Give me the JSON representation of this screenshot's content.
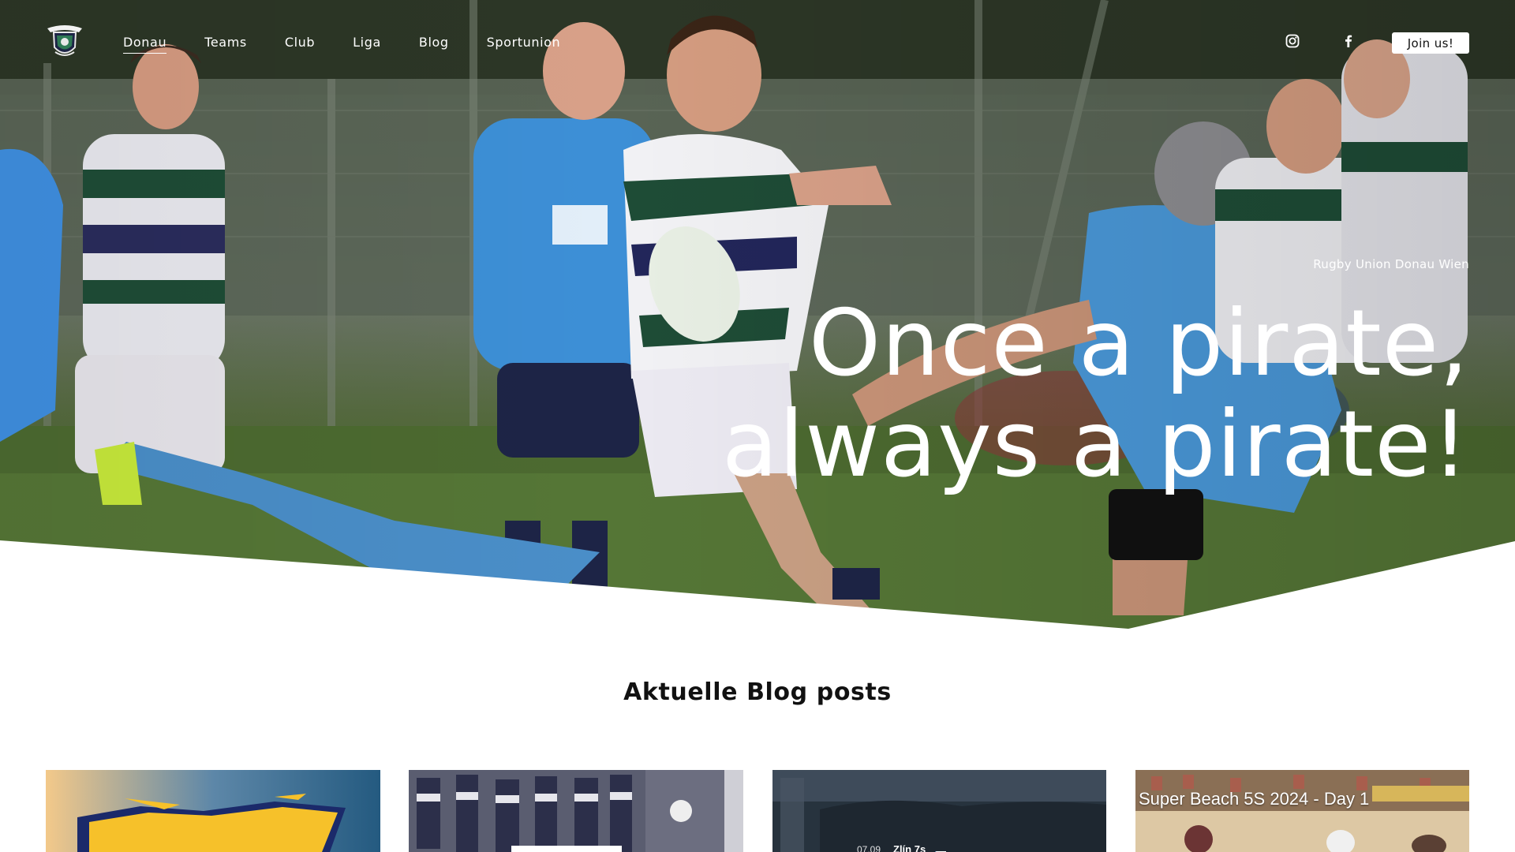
{
  "nav": {
    "logo_icon": "club-crest-icon",
    "links": [
      {
        "label": "Donau",
        "active": true
      },
      {
        "label": "Teams",
        "active": false
      },
      {
        "label": "Club",
        "active": false
      },
      {
        "label": "Liga",
        "active": false
      },
      {
        "label": "Blog",
        "active": false
      },
      {
        "label": "Sportunion",
        "active": false
      }
    ],
    "social_icons": [
      "instagram-icon",
      "facebook-icon"
    ],
    "join_label": "Join us!"
  },
  "hero": {
    "eyebrow": "Rugby Union Donau Wien",
    "title_line1": "Once a pirate,",
    "title_line2": "always a pirate!",
    "image": "rugby-match-photo"
  },
  "blog": {
    "section_title": "Aktuelle Blog posts",
    "cards": [
      {
        "image": "rugby-logo-artwork",
        "overlay": ""
      },
      {
        "image": "magazine-spread-photo",
        "overlay": ""
      },
      {
        "image": "dark-field-photo",
        "overlay_date": "07.09",
        "overlay_title": "Zlín 7s"
      },
      {
        "image": "beach-rugby-photo",
        "overlay": "Super Beach 5S 2024 - Day 1"
      }
    ]
  },
  "colors": {
    "white": "#ffffff",
    "club_green": "#1f4a34",
    "club_navy": "#20264e",
    "opponent_blue": "#3d8fd6"
  }
}
